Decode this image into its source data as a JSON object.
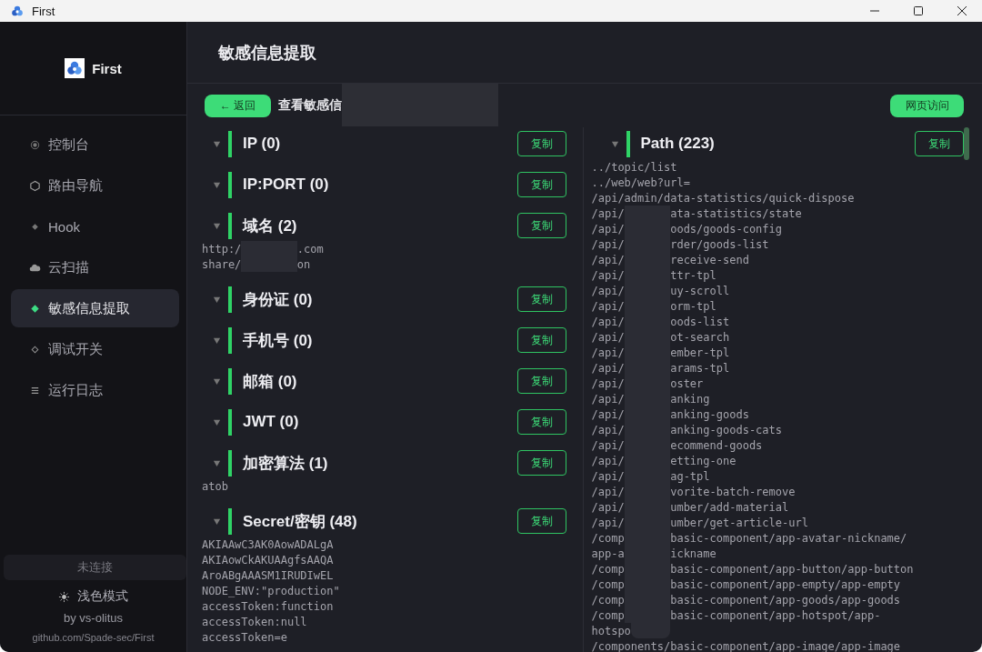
{
  "window": {
    "title": "First"
  },
  "sidebar": {
    "brand": "First",
    "items": [
      {
        "label": "控制台",
        "selected": false
      },
      {
        "label": "路由导航",
        "selected": false
      },
      {
        "label": "Hook",
        "selected": false
      },
      {
        "label": "云扫描",
        "selected": false
      },
      {
        "label": "敏感信息提取",
        "selected": true
      },
      {
        "label": "调试开关",
        "selected": false
      },
      {
        "label": "运行日志",
        "selected": false
      }
    ],
    "status": "未连接",
    "theme_toggle": "浅色模式",
    "author": "by vs-olitus",
    "repo": "github.com/Spade-sec/First"
  },
  "page": {
    "title": "敏感信息提取",
    "back_button": "← 返回",
    "subtitle": "查看敏感信",
    "visit_button": "网页访问"
  },
  "columns": [
    {
      "sections": [
        {
          "title": "IP (0)",
          "expanded": true,
          "copy_button": "复制"
        },
        {
          "title": "IP:PORT (0)",
          "expanded": true,
          "copy_button": "复制"
        },
        {
          "title": "域名 (2)",
          "expanded": true,
          "copy_button": "复制",
          "lines": [
            {
              "text": "http:/",
              "redacted": true,
              "rest": ".com"
            },
            {
              "text": "share/",
              "redacted": true,
              "rest": "on"
            }
          ]
        },
        {
          "title": "身份证 (0)",
          "expanded": true,
          "copy_button": "复制"
        },
        {
          "title": "手机号 (0)",
          "expanded": true,
          "copy_button": "复制"
        },
        {
          "title": "邮箱 (0)",
          "expanded": true,
          "copy_button": "复制"
        },
        {
          "title": "JWT (0)",
          "expanded": true,
          "copy_button": "复制"
        },
        {
          "title": "加密算法 (1)",
          "expanded": true,
          "copy_button": "复制",
          "lines": [
            {
              "text": "atob",
              "redacted": false
            }
          ]
        },
        {
          "title": "Secret/密钥 (48)",
          "expanded": true,
          "copy_button": "复制",
          "lines": [
            {
              "text": "AKIAAwC3AK0AowADALgA",
              "redacted": false
            },
            {
              "text": "AKIAowCkAKUAAgfsAAQA",
              "redacted": false
            },
            {
              "text": "AroABgAAASM1IRUDIwEL",
              "redacted": false
            },
            {
              "text": "NODE_ENV:\"production\"",
              "redacted": false
            },
            {
              "text": "accessToken:function",
              "redacted": false
            },
            {
              "text": "accessToken:null",
              "redacted": false
            },
            {
              "text": "accessToken=e",
              "redacted": false
            }
          ]
        }
      ]
    },
    {
      "sections": [
        {
          "title": "Path (223)",
          "expanded": true,
          "copy_button": "复制",
          "lines": [
            {
              "text": "../topic/list",
              "redacted": false
            },
            {
              "text": "../web/web?url=",
              "redacted": false
            },
            {
              "text": "/api/admin/data-statistics/quick-dispose",
              "redacted": false
            },
            {
              "text": "/api/",
              "redacted": true,
              "rest": "ata-statistics/state"
            },
            {
              "text": "/api/",
              "redacted": true,
              "rest": "oods/goods-config"
            },
            {
              "text": "/api/",
              "redacted": true,
              "rest": "rder/goods-list"
            },
            {
              "text": "/api/",
              "redacted": true,
              "rest": "receive-send"
            },
            {
              "text": "/api/",
              "redacted": true,
              "rest": "ttr-tpl"
            },
            {
              "text": "/api/",
              "redacted": true,
              "rest": "uy-scroll"
            },
            {
              "text": "/api/",
              "redacted": true,
              "rest": "orm-tpl"
            },
            {
              "text": "/api/",
              "redacted": true,
              "rest": "oods-list"
            },
            {
              "text": "/api/",
              "redacted": true,
              "rest": "ot-search"
            },
            {
              "text": "/api/",
              "redacted": true,
              "rest": "ember-tpl"
            },
            {
              "text": "/api/",
              "redacted": true,
              "rest": "arams-tpl"
            },
            {
              "text": "/api/",
              "redacted": true,
              "rest": "oster"
            },
            {
              "text": "/api/",
              "redacted": true,
              "rest": "anking"
            },
            {
              "text": "/api/",
              "redacted": true,
              "rest": "anking-goods"
            },
            {
              "text": "/api/",
              "redacted": true,
              "rest": "anking-goods-cats"
            },
            {
              "text": "/api/",
              "redacted": true,
              "rest": "ecommend-goods"
            },
            {
              "text": "/api/",
              "redacted": true,
              "rest": "etting-one"
            },
            {
              "text": "/api/",
              "redacted": true,
              "rest": "ag-tpl"
            },
            {
              "text": "/api/",
              "redacted": true,
              "rest": "vorite-batch-remove"
            },
            {
              "text": "/api/",
              "redacted": true,
              "rest": "umber/add-material"
            },
            {
              "text": "/api/",
              "redacted": true,
              "rest": "umber/get-article-url"
            },
            {
              "text": "/comp",
              "redacted": true,
              "rest": "basic-component/app-avatar-nickname/"
            },
            {
              "text": "app-a",
              "redacted": true,
              "rest": "ickname"
            },
            {
              "text": "/comp",
              "redacted": true,
              "rest": "basic-component/app-button/app-button"
            },
            {
              "text": "/comp",
              "redacted": true,
              "rest": "basic-component/app-empty/app-empty"
            },
            {
              "text": "/comp",
              "redacted": true,
              "rest": "basic-component/app-goods/app-goods"
            },
            {
              "text": "/comp",
              "redacted": true,
              "rest": "basic-component/app-hotspot/app-"
            },
            {
              "text": "hotspo",
              "redacted": true
            },
            {
              "text": "/components/basic-component/app-image/app-image",
              "redacted": false
            }
          ]
        }
      ]
    }
  ]
}
